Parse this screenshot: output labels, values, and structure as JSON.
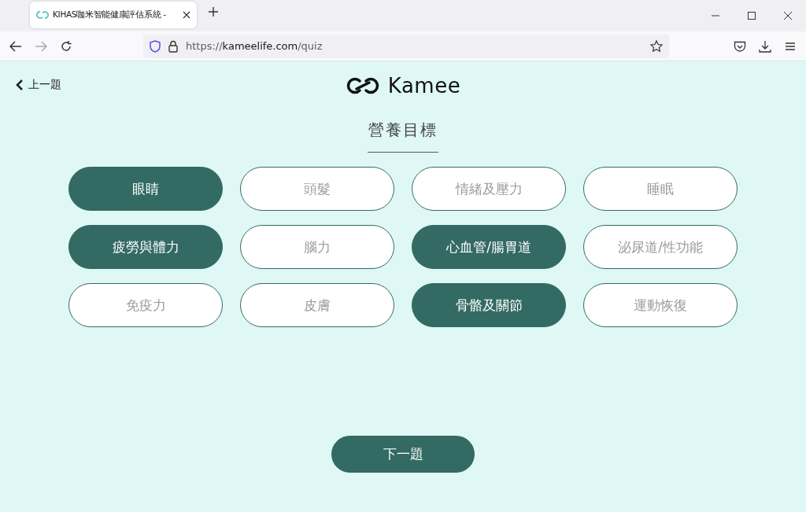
{
  "browser": {
    "tab_title": "KIHAS咖米智能健康評估系統 -",
    "url_scheme": "https://",
    "url_host": "kameelife.com",
    "url_path": "/quiz"
  },
  "header": {
    "back_label": "上一題",
    "logo_text": "Kamee"
  },
  "question": {
    "title": "營養目標"
  },
  "options": [
    {
      "label": "眼睛",
      "selected": true
    },
    {
      "label": "頭髮",
      "selected": false
    },
    {
      "label": "情緒及壓力",
      "selected": false
    },
    {
      "label": "睡眠",
      "selected": false
    },
    {
      "label": "疲勞與體力",
      "selected": true
    },
    {
      "label": "腦力",
      "selected": false
    },
    {
      "label": "心血管/腸胃道",
      "selected": true
    },
    {
      "label": "泌尿道/性功能",
      "selected": false
    },
    {
      "label": "免疫力",
      "selected": false
    },
    {
      "label": "皮膚",
      "selected": false
    },
    {
      "label": "骨骼及關節",
      "selected": true
    },
    {
      "label": "運動恢復",
      "selected": false
    }
  ],
  "next_button": {
    "label": "下一題"
  }
}
